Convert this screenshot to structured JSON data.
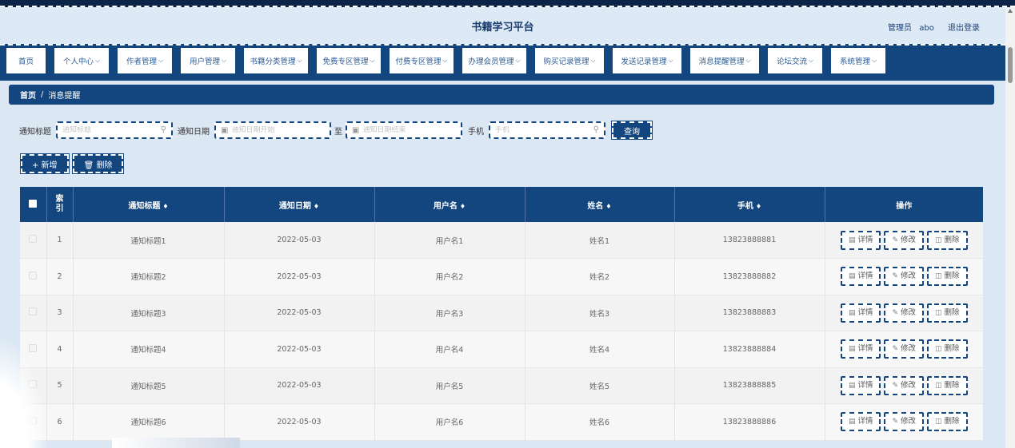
{
  "header": {
    "site_title": "书籍学习平台",
    "role": "管理员",
    "username": "abo",
    "logout": "退出登录"
  },
  "nav": [
    {
      "label": "首页",
      "has_menu": false
    },
    {
      "label": "个人中心",
      "has_menu": true
    },
    {
      "label": "作者管理",
      "has_menu": true
    },
    {
      "label": "用户管理",
      "has_menu": true
    },
    {
      "label": "书籍分类管理",
      "has_menu": true
    },
    {
      "label": "免费专区管理",
      "has_menu": true
    },
    {
      "label": "付费专区管理",
      "has_menu": true
    },
    {
      "label": "办理会员管理",
      "has_menu": true
    },
    {
      "label": "购买记录管理",
      "has_menu": true
    },
    {
      "label": "发送记录管理",
      "has_menu": true
    },
    {
      "label": "消息提醒管理",
      "has_menu": true
    },
    {
      "label": "论坛交流",
      "has_menu": true
    },
    {
      "label": "系统管理",
      "has_menu": true
    }
  ],
  "breadcrumb": {
    "home": "首页",
    "separator": "/",
    "current": "消息提醒"
  },
  "search": {
    "title_label": "通知标题",
    "title_placeholder": "通知标题",
    "date_label": "通知日期",
    "date_start_placeholder": "通知日期开始",
    "date_to": "至",
    "date_end_placeholder": "通知日期结束",
    "phone_label": "手机",
    "phone_placeholder": "手机",
    "query_button": "查询"
  },
  "actions": {
    "add": "+ 新增",
    "delete": "删除"
  },
  "table": {
    "headers": {
      "index": "索引",
      "title": "通知标题",
      "date": "通知日期",
      "username": "用户名",
      "name": "姓名",
      "phone": "手机",
      "ops": "操作"
    },
    "rows": [
      {
        "index": "1",
        "title": "通知标题1",
        "date": "2022-05-03",
        "username": "用户名1",
        "name": "姓名1",
        "phone": "13823888881"
      },
      {
        "index": "2",
        "title": "通知标题2",
        "date": "2022-05-03",
        "username": "用户名2",
        "name": "姓名2",
        "phone": "13823888882"
      },
      {
        "index": "3",
        "title": "通知标题3",
        "date": "2022-05-03",
        "username": "用户名3",
        "name": "姓名3",
        "phone": "13823888883"
      },
      {
        "index": "4",
        "title": "通知标题4",
        "date": "2022-05-03",
        "username": "用户名4",
        "name": "姓名4",
        "phone": "13823888884"
      },
      {
        "index": "5",
        "title": "通知标题5",
        "date": "2022-05-03",
        "username": "用户名5",
        "name": "姓名5",
        "phone": "13823888885"
      },
      {
        "index": "6",
        "title": "通知标题6",
        "date": "2022-05-03",
        "username": "用户名6",
        "name": "姓名6",
        "phone": "13823888886"
      }
    ],
    "row_ops": {
      "detail": "详情",
      "edit": "修改",
      "delete": "删除"
    }
  },
  "colors": {
    "primary": "#13467f",
    "background": "#dbe8f4"
  }
}
